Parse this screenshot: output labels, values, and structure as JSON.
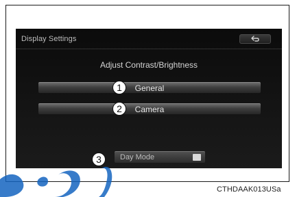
{
  "screen": {
    "title": "Display Settings",
    "subtitle": "Adjust Contrast/Brightness",
    "buttons": [
      {
        "label": "General",
        "callout": "1"
      },
      {
        "label": "Camera",
        "callout": "2"
      }
    ],
    "day_mode": {
      "label": "Day Mode",
      "callout": "3"
    }
  },
  "figure_code": "CTHDAAK013USa",
  "icons": {
    "back": "back-arrow-icon"
  },
  "colors": {
    "screen_bg": "#0b0b0b",
    "button_top": "#6a6a6a",
    "text": "#e8e8e8",
    "watermark": "#1565c0"
  }
}
